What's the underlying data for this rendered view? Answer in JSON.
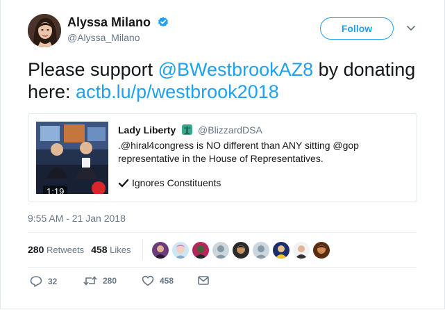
{
  "author": {
    "display_name": "Alyssa Milano",
    "handle": "@Alyssa_Milano",
    "verified_icon": "verified-badge-icon",
    "avatar_icon": "profile-avatar"
  },
  "follow_label": "Follow",
  "tweet": {
    "text_1": "Please support ",
    "mention": "@BWestbrookAZ8",
    "text_2": " by donating here: ",
    "link": "actb.lu/p/westbrook2018"
  },
  "quote": {
    "name": "Lady Liberty",
    "emoji_icon": "statue-of-liberty-icon",
    "handle": "@BlizzardDSA",
    "text": ".@hiral4congress is NO different than ANY sitting @gop representative in the House of Representatives.",
    "check_text": "Ignores Constituents",
    "video_duration": "1:19"
  },
  "timestamp": "9:55 AM - 21 Jan 2018",
  "stats": {
    "retweets_count": "280",
    "retweets_label": "Retweets",
    "likes_count": "458",
    "likes_label": "Likes"
  },
  "actions": {
    "reply_count": "32",
    "retweet_count": "280",
    "like_count": "458"
  },
  "colors": {
    "accent": "#1da1f2",
    "text": "#14171a",
    "muted": "#657786",
    "border": "#e1e8ed"
  }
}
